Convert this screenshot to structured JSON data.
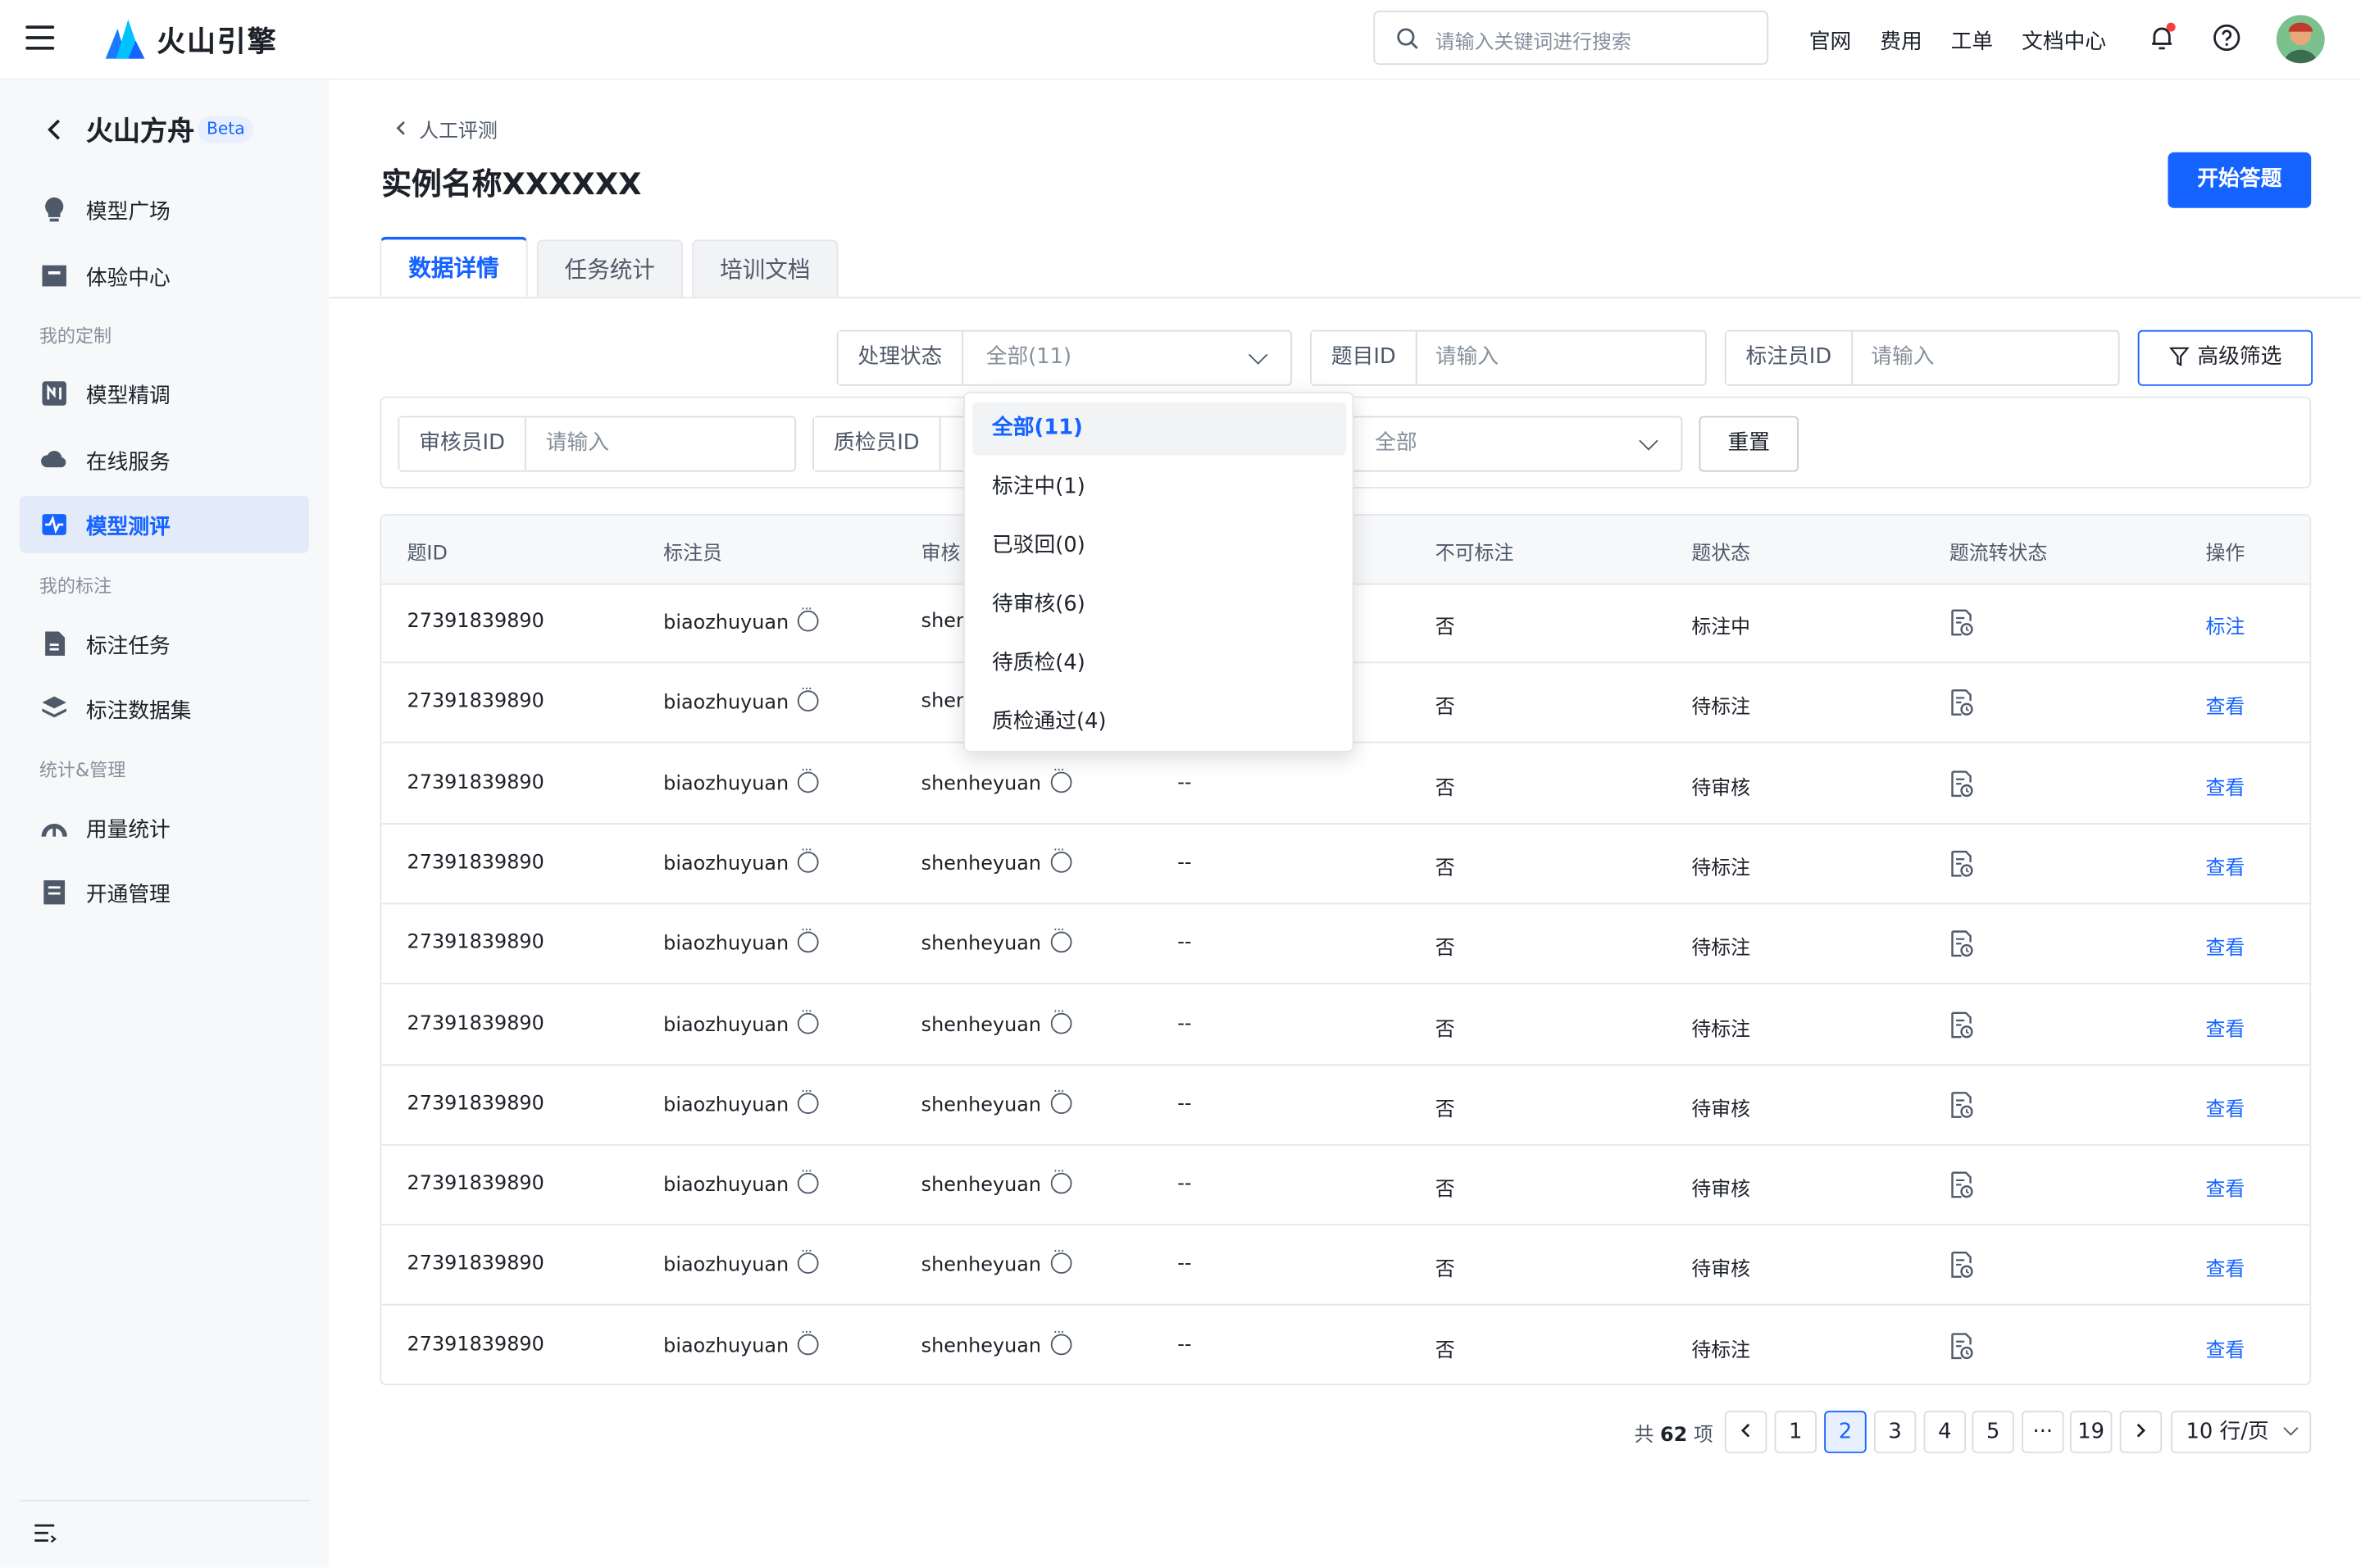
{
  "header": {
    "brand": "火山引擎",
    "search_placeholder": "请输入关键词进行搜索",
    "nav": [
      "官网",
      "费用",
      "工单",
      "文档中心"
    ]
  },
  "sidebar": {
    "title": "火山方舟",
    "badge": "Beta",
    "items": [
      {
        "label": "模型广场",
        "icon": "bulb-icon"
      },
      {
        "label": "体验中心",
        "icon": "box-icon"
      },
      {
        "label": "模型精调",
        "icon": "tune-icon"
      },
      {
        "label": "在线服务",
        "icon": "cloud-icon"
      },
      {
        "label": "模型测评",
        "icon": "pulse-icon",
        "active": true
      },
      {
        "label": "标注任务",
        "icon": "doc-icon"
      },
      {
        "label": "标注数据集",
        "icon": "layers-icon"
      },
      {
        "label": "用量统计",
        "icon": "gauge-icon"
      },
      {
        "label": "开通管理",
        "icon": "list-icon"
      }
    ],
    "groups": [
      "我的定制",
      "我的标注",
      "统计&管理"
    ]
  },
  "page": {
    "breadcrumb": "人工评测",
    "title": "实例名称XXXXXX",
    "start_button": "开始答题",
    "tabs": [
      "数据详情",
      "任务统计",
      "培训文档"
    ]
  },
  "filters": {
    "status_label": "处理状态",
    "status_value": "全部(11)",
    "question_id_label": "题目ID",
    "annotator_id_label": "标注员ID",
    "reviewer_id_label": "审核员ID",
    "qc_id_label": "质检员ID",
    "input_placeholder": "请输入",
    "select_all": "全部",
    "advanced_button": "高级筛选",
    "reset_button": "重置"
  },
  "dropdown": {
    "options": [
      "全部(11)",
      "标注中(1)",
      "已驳回(0)",
      "待审核(6)",
      "待质检(4)",
      "质检通过(4)"
    ]
  },
  "table": {
    "columns": [
      "题ID",
      "标注员",
      "审核",
      "不可标注",
      "题状态",
      "题流转状态",
      "操作"
    ],
    "rows": [
      {
        "id": "27391839890",
        "annotator": "biaozhuyuan",
        "reviewer": "shen",
        "qc": "",
        "unavailable": "否",
        "status": "标注中",
        "action": "标注"
      },
      {
        "id": "27391839890",
        "annotator": "biaozhuyuan",
        "reviewer": "shen",
        "qc": "",
        "unavailable": "否",
        "status": "待标注",
        "action": "查看"
      },
      {
        "id": "27391839890",
        "annotator": "biaozhuyuan",
        "reviewer": "shenheyuan",
        "qc": "--",
        "unavailable": "否",
        "status": "待审核",
        "action": "查看"
      },
      {
        "id": "27391839890",
        "annotator": "biaozhuyuan",
        "reviewer": "shenheyuan",
        "qc": "--",
        "unavailable": "否",
        "status": "待标注",
        "action": "查看"
      },
      {
        "id": "27391839890",
        "annotator": "biaozhuyuan",
        "reviewer": "shenheyuan",
        "qc": "--",
        "unavailable": "否",
        "status": "待标注",
        "action": "查看"
      },
      {
        "id": "27391839890",
        "annotator": "biaozhuyuan",
        "reviewer": "shenheyuan",
        "qc": "--",
        "unavailable": "否",
        "status": "待标注",
        "action": "查看"
      },
      {
        "id": "27391839890",
        "annotator": "biaozhuyuan",
        "reviewer": "shenheyuan",
        "qc": "--",
        "unavailable": "否",
        "status": "待审核",
        "action": "查看"
      },
      {
        "id": "27391839890",
        "annotator": "biaozhuyuan",
        "reviewer": "shenheyuan",
        "qc": "--",
        "unavailable": "否",
        "status": "待审核",
        "action": "查看"
      },
      {
        "id": "27391839890",
        "annotator": "biaozhuyuan",
        "reviewer": "shenheyuan",
        "qc": "--",
        "unavailable": "否",
        "status": "待审核",
        "action": "查看"
      },
      {
        "id": "27391839890",
        "annotator": "biaozhuyuan",
        "reviewer": "shenheyuan",
        "qc": "--",
        "unavailable": "否",
        "status": "待标注",
        "action": "查看"
      }
    ]
  },
  "pagination": {
    "total_prefix": "共",
    "total": "62",
    "total_suffix": "项",
    "pages": [
      "1",
      "2",
      "3",
      "4",
      "5",
      "···",
      "19"
    ],
    "current": "2",
    "page_size": "10 行/页"
  },
  "colors": {
    "primary": "#1664ff",
    "sidebar_bg": "#f7f8fa",
    "active_bg": "#e3ebf9"
  }
}
